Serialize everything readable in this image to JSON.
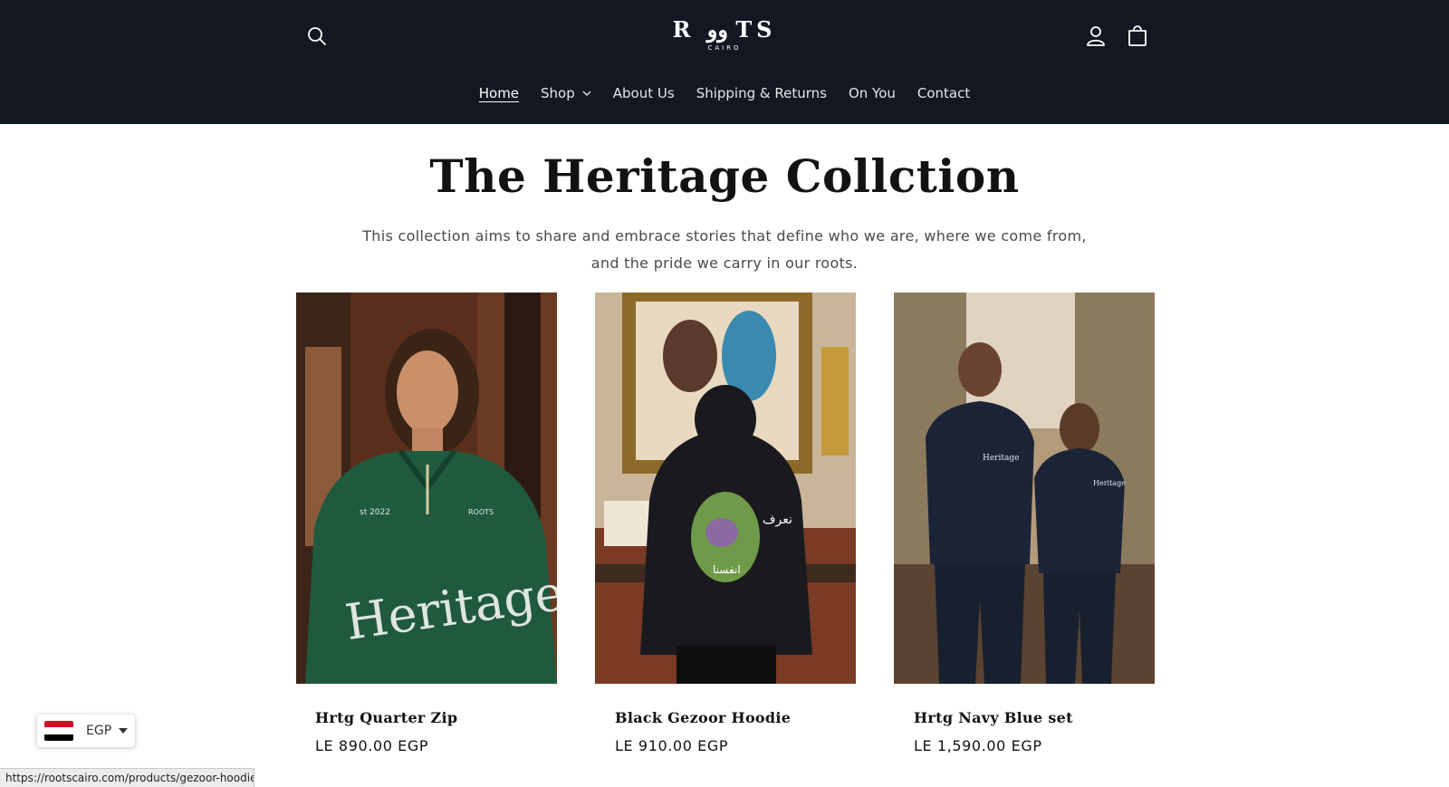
{
  "header": {
    "logo_text": "R وو TS",
    "logo_sub": "CAIRO",
    "icons": {
      "search": "search-icon",
      "account": "user-icon",
      "cart": "cart-icon"
    },
    "background": "#131722"
  },
  "nav": {
    "items": [
      {
        "label": "Home",
        "active": true
      },
      {
        "label": "Shop",
        "has_dropdown": true
      },
      {
        "label": "About Us"
      },
      {
        "label": "Shipping & Returns"
      },
      {
        "label": "On You"
      },
      {
        "label": "Contact"
      }
    ]
  },
  "main": {
    "title": "The Heritage Collction",
    "description": "This collection aims to share and embrace stories that define who we are, where we come from, and the pride we carry in our roots."
  },
  "products": [
    {
      "name": "Hrtg Quarter Zip",
      "price": "LE 890.00 EGP",
      "image_color": "#1f5a3f",
      "print": "Heritage"
    },
    {
      "name": "Black Gezoor Hoodie",
      "price": "LE 910.00 EGP",
      "image_color": "#1a1a1e",
      "print": ""
    },
    {
      "name": "Hrtg Navy Blue set",
      "price": "LE 1,590.00 EGP",
      "image_color": "#1b2436",
      "print": ""
    }
  ],
  "currency": {
    "code": "EGP",
    "flag": "egypt-flag-icon"
  },
  "status_url": "https://rootscairo.com/products/gezoor-hoodie"
}
